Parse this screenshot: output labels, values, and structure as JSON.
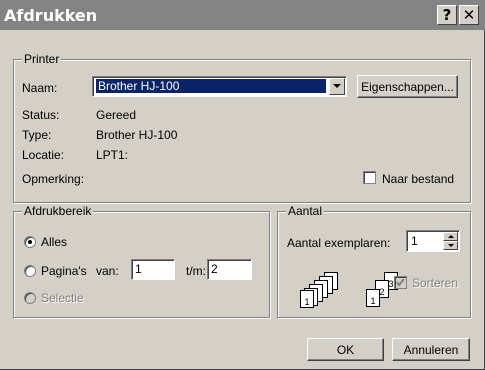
{
  "window": {
    "title": "Afdrukken",
    "help_glyph": "?",
    "close_glyph": "✕"
  },
  "printer": {
    "legend": "Printer",
    "name_label": "Naam:",
    "name_value": "Brother HJ-100",
    "properties_button": "Eigenschappen...",
    "status_label": "Status:",
    "status_value": "Gereed",
    "type_label": "Type:",
    "type_value": "Brother HJ-100",
    "location_label": "Locatie:",
    "location_value": "LPT1:",
    "comment_label": "Opmerking:",
    "print_to_file_label": "Naar bestand",
    "print_to_file_checked": false
  },
  "range": {
    "legend": "Afdrukbereik",
    "all_label": "Alles",
    "all_selected": true,
    "pages_label": "Pagina's",
    "from_label": "van:",
    "from_value": "1",
    "to_label": "t/m:",
    "to_value": "2",
    "selection_label": "Selectie"
  },
  "copies": {
    "legend": "Aantal",
    "count_label": "Aantal exemplaren:",
    "count_value": "1",
    "collate_label": "Sorteren",
    "collate_checked": true,
    "uncollated_pages": [
      "1",
      "2",
      "3"
    ],
    "collated_pages": [
      "1",
      "2",
      "3"
    ]
  },
  "buttons": {
    "ok": "OK",
    "cancel": "Annuleren"
  }
}
